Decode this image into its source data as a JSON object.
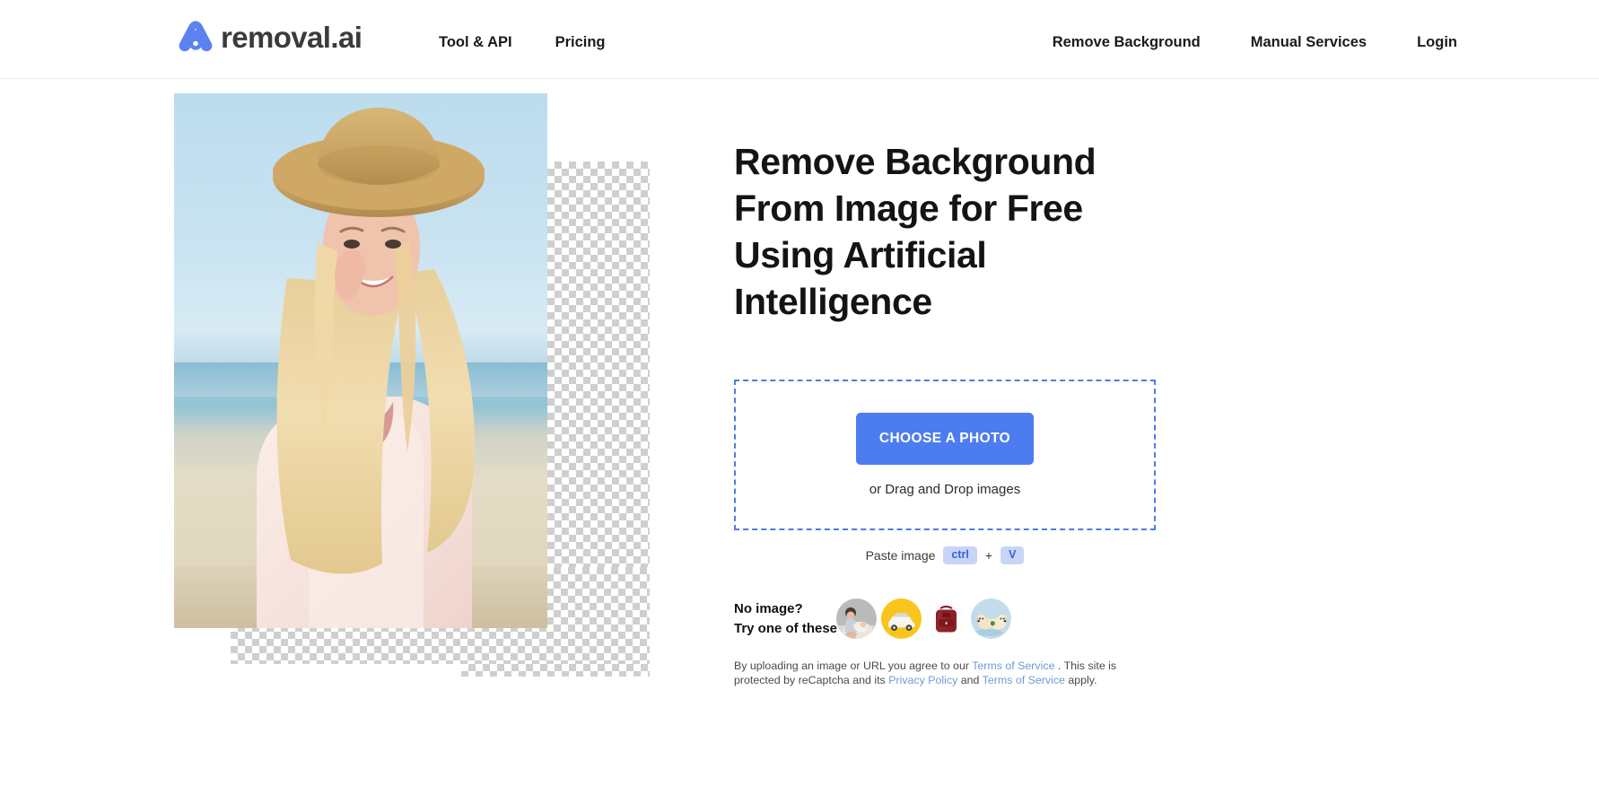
{
  "header": {
    "brand": {
      "name": "removal.ai",
      "logo_icon": "removal-ai-logo-icon",
      "accent": "#5b82ef"
    },
    "nav_left": [
      {
        "label": "Tool & API"
      },
      {
        "label": "Pricing"
      }
    ],
    "nav_right": [
      {
        "label": "Remove Background"
      },
      {
        "label": "Manual Services"
      },
      {
        "label": "Login"
      }
    ]
  },
  "hero": {
    "preview_alt": "woman-in-straw-hat-on-beach-background-removed",
    "headline": "Remove Background From Image for Free Using Artificial Intelligence"
  },
  "upload": {
    "button_label": "CHOOSE A PHOTO",
    "drag_text": "or Drag and Drop images",
    "paste_label": "Paste image",
    "key_ctrl": "ctrl",
    "key_plus": "+",
    "key_v": "V",
    "dropzone_border_color": "#4a7ce8",
    "button_color": "#4c7df0"
  },
  "samples": {
    "label_line1": "No image?",
    "label_line2": "Try one of these",
    "items": [
      {
        "name": "sample-family",
        "icon": "family-photo-icon",
        "bg": "#b6b7b9"
      },
      {
        "name": "sample-car",
        "icon": "car-photo-icon",
        "bg": "#f7c221"
      },
      {
        "name": "sample-backpack",
        "icon": "backpack-photo-icon",
        "bg": "#ffffff"
      },
      {
        "name": "sample-dogs",
        "icon": "dogs-photo-icon",
        "bg": "#bfdcea"
      }
    ]
  },
  "legal": {
    "part1": "By uploading an image or URL you agree to our ",
    "terms1": "Terms of Service",
    "part2": " . This site is protected by reCaptcha and its ",
    "privacy": "Privacy Policy",
    "part3": " and ",
    "terms2": "Terms of Service",
    "part4": " apply."
  }
}
